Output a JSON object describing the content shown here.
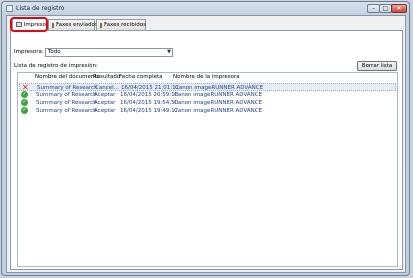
{
  "window": {
    "title": "Lista de registro",
    "min_glyph": "–",
    "max_glyph": "□",
    "close_glyph": "✕"
  },
  "tabs": [
    {
      "label": "Impreso",
      "icon": "printer-icon"
    },
    {
      "label": "Faxes enviados",
      "icon": "fax-icon"
    },
    {
      "label": "Faxes recibidos",
      "icon": "fax-icon"
    }
  ],
  "filter": {
    "label": "Impresora:",
    "value": "Todo",
    "arrow": "▼"
  },
  "list_label": "Lista de registro de impresión:",
  "clear_button": "Borrar lista",
  "columns": [
    "Nombre del documento",
    "Resultado",
    "Fecha completa",
    "Nombre de la impresora"
  ],
  "rows": [
    {
      "status": "error",
      "status_glyph": "✕",
      "document": "Summary of Research",
      "result": "Cancel...",
      "date": "16/04/2015 21:01:11",
      "printer": "Canon imageRUNNER ADVANCE"
    },
    {
      "status": "ok",
      "status_glyph": "✓",
      "document": "Summary of Research",
      "result": "Aceptar",
      "date": "16/04/2015 20:59:18",
      "printer": "Canon imageRUNNER ADVANCE"
    },
    {
      "status": "ok",
      "status_glyph": "✓",
      "document": "Summary of Research",
      "result": "Aceptar",
      "date": "16/04/2015 19:54:50",
      "printer": "Canon imageRUNNER ADVANCE"
    },
    {
      "status": "ok",
      "status_glyph": "✓",
      "document": "Summary of Research",
      "result": "Aceptar",
      "date": "16/04/2015 19:49:17",
      "printer": "Canon imageRUNNER ADVANCE"
    }
  ],
  "colors": {
    "accent": "#e30613",
    "link_text": "#23408e",
    "ok": "#3aa63a",
    "error": "#d9261c"
  }
}
